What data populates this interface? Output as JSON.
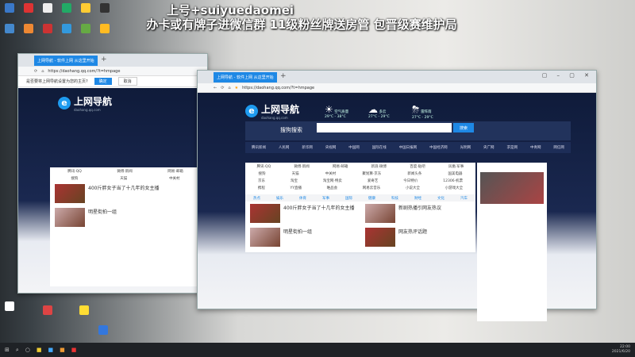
{
  "overlay": {
    "line1": "上号+suiyuedaomei",
    "line2": "办卡或有牌子进微信群 11级粉丝牌送房管  包晋级赛维护局"
  },
  "browser": {
    "tab_title": "上网导航 - 软件上网 从这里开始",
    "url": "https://daohang.qq.com/?t=hmpage",
    "new_tab": "+",
    "window_controls": "▢ – ▢ ✕"
  },
  "infobar": {
    "question": "是否要将上网导航设置为您的主页?",
    "confirm": "确定",
    "cancel": "取消"
  },
  "page": {
    "logo_title": "上网导航",
    "logo_sub": "daohang.qq.com",
    "weather": [
      {
        "label": "空气质量",
        "temp": "29°C - 38°C",
        "icon": "☀"
      },
      {
        "label": "多云",
        "temp": "27°C - 29°C",
        "icon": "☁"
      },
      {
        "label": "雷阵雨",
        "temp": "27°C - 29°C",
        "icon": "⛈"
      }
    ],
    "search_label": "搜狗搜索",
    "search_button": "搜索",
    "subnav": [
      "腾讯新闻",
      "人民网",
      "新华网",
      "央视网",
      "中国网",
      "国际在线",
      "中国日报网",
      "中国经济网",
      "光明网",
      "央广网",
      "求是网",
      "中青网",
      "网信网"
    ],
    "sites": [
      [
        "腾讯·QQ",
        "微博·新闻",
        "网易·邮箱",
        "新浪·微博",
        "百度·贴吧",
        "凤凰·军事"
      ],
      [
        "搜狗",
        "天猫",
        "中关村",
        "聚划算·京东",
        "新闻头条",
        "国美电器"
      ],
      [
        "京东",
        "淘宝",
        "淘宝网·特卖",
        "爱奇艺",
        "今日特价",
        "12306·机票"
      ],
      [
        "携程",
        "YY直播",
        "唯品会",
        "网易云音乐",
        "小说大全",
        "小游戏大全"
      ]
    ],
    "tabs": [
      "热点",
      "娱乐",
      "体育",
      "军事",
      "国际",
      "健康",
      "科技",
      "财经",
      "文化",
      "汽车"
    ],
    "news": [
      "400斤胖女子当了十几年的女主播",
      "新剧热播引网友热议",
      "明星街拍一组",
      "网友热评话题"
    ]
  },
  "taskbar": {
    "time": "22:00",
    "date": "2021/6/20"
  }
}
